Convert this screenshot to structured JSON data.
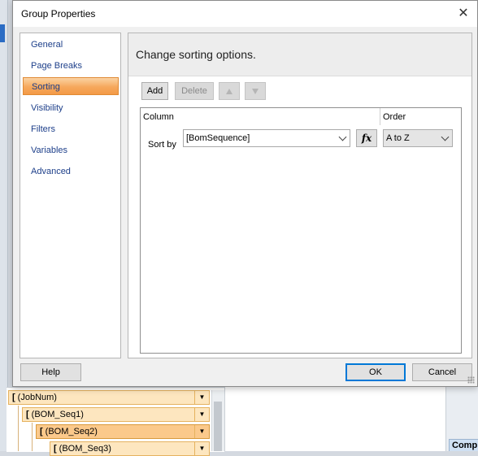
{
  "dialog": {
    "title": "Group Properties",
    "close_glyph": "✕"
  },
  "nav": {
    "items": [
      {
        "label": "General"
      },
      {
        "label": "Page Breaks"
      },
      {
        "label": "Sorting"
      },
      {
        "label": "Visibility"
      },
      {
        "label": "Filters"
      },
      {
        "label": "Variables"
      },
      {
        "label": "Advanced"
      }
    ],
    "selected_index": 2
  },
  "sorting": {
    "heading": "Change sorting options.",
    "toolbar": {
      "add_label": "Add",
      "delete_label": "Delete"
    },
    "columns": {
      "column_header": "Column",
      "order_header": "Order"
    },
    "rows": [
      {
        "label": "Sort by",
        "expression": "[BomSequence]",
        "fx_label": "fx",
        "order": "A to Z"
      }
    ]
  },
  "footer": {
    "help_label": "Help",
    "ok_label": "OK",
    "cancel_label": "Cancel"
  },
  "background": {
    "row_groups": [
      {
        "label": "(JobNum)"
      },
      {
        "label": "(BOM_Seq1)"
      },
      {
        "label": "(BOM_Seq2)"
      },
      {
        "label": "(BOM_Seq3)"
      }
    ],
    "right_panel_label": "Comp"
  },
  "colors": {
    "nav_selected": "#f6a85c",
    "nav_text": "#1d3f8a",
    "ok_border": "#0078d7",
    "group_fill": "#fde6bf"
  }
}
